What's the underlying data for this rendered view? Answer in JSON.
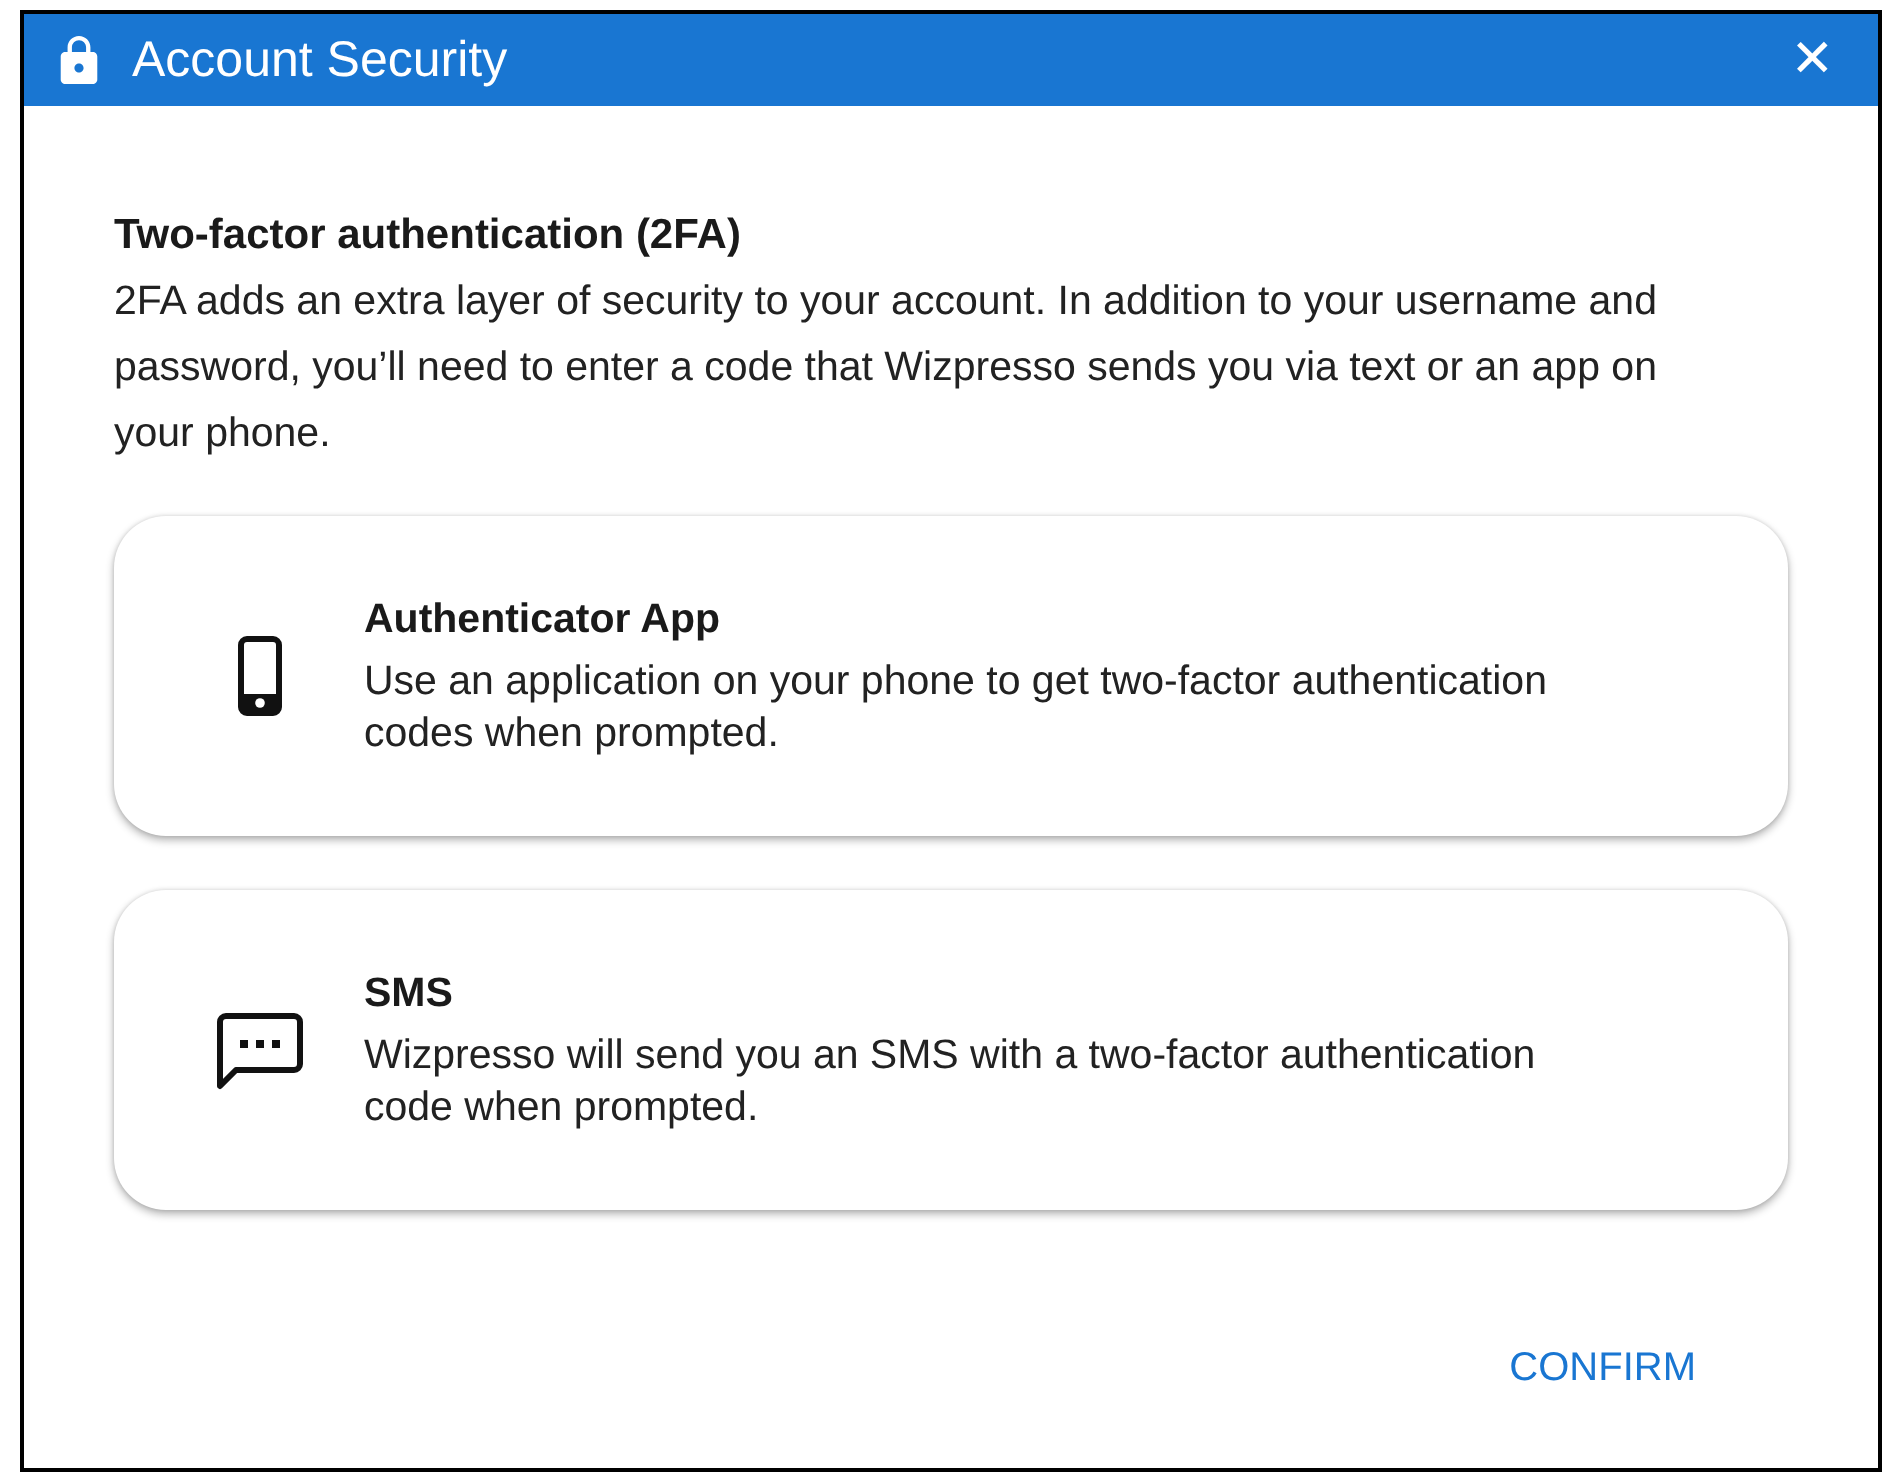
{
  "window": {
    "title": "Account Security",
    "close_label": "✕"
  },
  "intro": {
    "heading": "Two-factor authentication (2FA)",
    "text": "2FA adds an extra layer of security to your account. In addition to your username and password, you’ll need to enter a code that Wizpresso sends you via text or an app on your phone."
  },
  "options": [
    {
      "kind": "app",
      "title": "Authenticator App",
      "description": "Use an application on your phone to get two-factor authentication codes when prompted."
    },
    {
      "kind": "sms",
      "title": "SMS",
      "description": "Wizpresso will send you an SMS with a two-factor authentication code when prompted."
    }
  ],
  "buttons": [
    "CONFIRM"
  ]
}
